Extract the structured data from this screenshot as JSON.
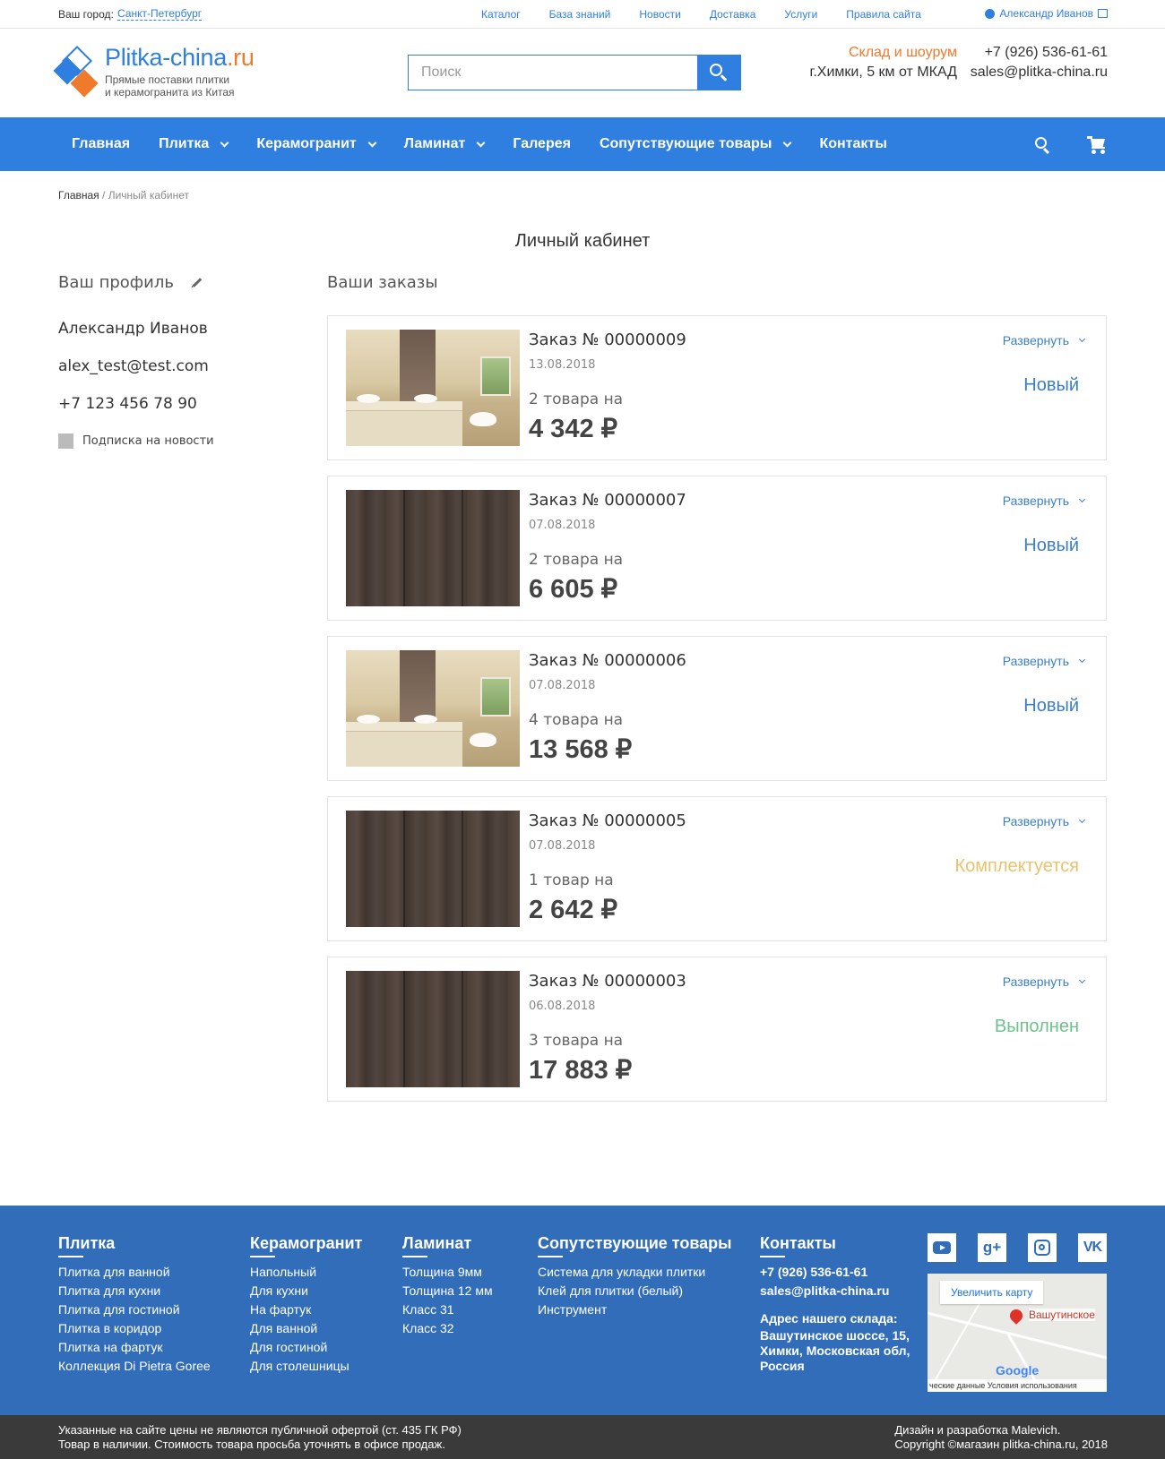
{
  "topbar": {
    "city_label": "Ваш город:",
    "city": "Санкт-Петербург",
    "links": [
      "Каталог",
      "База знаний",
      "Новости",
      "Доставка",
      "Услуги",
      "Правила сайта"
    ],
    "user": "Александр Иванов"
  },
  "header": {
    "brand_main": "Plitka-china",
    "brand_tld": ".ru",
    "tagline_1": "Прямые поставки плитки",
    "tagline_2": "и керамогранита из Китая",
    "search_placeholder": "Поиск",
    "storage_1": "Склад и шоурум",
    "storage_2": "г.Химки, 5 км от МКАД",
    "phone": "+7 (926) 536-61-61",
    "email": "sales@plitka-china.ru"
  },
  "nav": {
    "items": [
      {
        "label": "Главная",
        "dropdown": false
      },
      {
        "label": "Плитка",
        "dropdown": true
      },
      {
        "label": "Керамогранит",
        "dropdown": true
      },
      {
        "label": "Ламинат",
        "dropdown": true
      },
      {
        "label": "Галерея",
        "dropdown": false
      },
      {
        "label": "Сопутствующие товары",
        "dropdown": true
      },
      {
        "label": "Контакты",
        "dropdown": false
      }
    ]
  },
  "breadcrumb": {
    "home": "Главная",
    "separator": " / ",
    "current": "Личный кабинет"
  },
  "page_title": "Личный кабинет",
  "profile": {
    "heading": "Ваш профиль",
    "name": "Александр Иванов",
    "email": "alex_test@test.com",
    "phone": "+7 123 456 78 90",
    "subscribe": "Подписка на новости"
  },
  "orders": {
    "heading": "Ваши заказы",
    "expand_label": "Развернуть",
    "items": [
      {
        "number": "Заказ № 00000009",
        "date": "13.08.2018",
        "qty": "2 товара на",
        "sum": "4 342 ₽",
        "status": "Новый",
        "status_kind": "new",
        "thumb": "bath"
      },
      {
        "number": "Заказ № 00000007",
        "date": "07.08.2018",
        "qty": "2 товара на",
        "sum": "6 605 ₽",
        "status": "Новый",
        "status_kind": "new",
        "thumb": "wood"
      },
      {
        "number": "Заказ № 00000006",
        "date": "07.08.2018",
        "qty": "4 товара на",
        "sum": "13 568 ₽",
        "status": "Новый",
        "status_kind": "new",
        "thumb": "bath"
      },
      {
        "number": "Заказ № 00000005",
        "date": "07.08.2018",
        "qty": "1 товар на",
        "sum": "2 642 ₽",
        "status": "Комплектуется",
        "status_kind": "prog",
        "thumb": "wood"
      },
      {
        "number": "Заказ № 00000003",
        "date": "06.08.2018",
        "qty": "3 товара на",
        "sum": "17 883 ₽",
        "status": "Выполнен",
        "status_kind": "done",
        "thumb": "wood"
      }
    ]
  },
  "footer": {
    "cols": [
      {
        "title": "Плитка",
        "links": [
          "Плитка для ванной",
          "Плитка для кухни",
          "Плитка для гостиной",
          "Плитка в коридор",
          "Плитка на фартук",
          "Коллекция Di Pietra Goree"
        ]
      },
      {
        "title": "Керамогранит",
        "links": [
          "Напольный",
          "Для кухни",
          "На фартук",
          "Для ванной",
          "Для гостиной",
          "Для столешницы"
        ]
      },
      {
        "title": "Ламинат",
        "links": [
          "Толщина 9мм",
          "Толщина 12 мм",
          "Класс 31",
          "Класс 32"
        ]
      },
      {
        "title": "Сопутствующие товары",
        "links": [
          "Система для укладки плитки",
          "Клей для плитки (белый)",
          "Инструмент"
        ]
      }
    ],
    "contacts": {
      "title": "Контакты",
      "phone": "+7 (926) 536-61-61",
      "email": "sales@plitka-china.ru",
      "address_label": "Адрес нашего склада:",
      "address": "Вашутинское шоссе, 15, Химки, Московская обл, Россия"
    },
    "map": {
      "enlarge": "Увеличить карту",
      "place": "Вашутинское",
      "google": "Google",
      "terms": "ческие данные   Условия использования"
    },
    "social_vk": "VK",
    "social_g": "g+",
    "bottom_left_1": "Указанные на сайте цены не являются публичной офертой (ст. 435 ГК РФ)",
    "bottom_left_2": "Товар в наличии. Стоимость товара просьба уточнять в офисе продаж.",
    "bottom_right_1": "Дизайн и разработка Malevich.",
    "bottom_right_2": "Copyright ©магазин plitka-china.ru, 2018"
  },
  "colors": {
    "accent": "#2f7fe0",
    "orange": "#f07a2c",
    "footer": "#316db8",
    "status_new": "#3a7fc7",
    "status_prog": "#e8c36c",
    "status_done": "#6cc28a"
  }
}
